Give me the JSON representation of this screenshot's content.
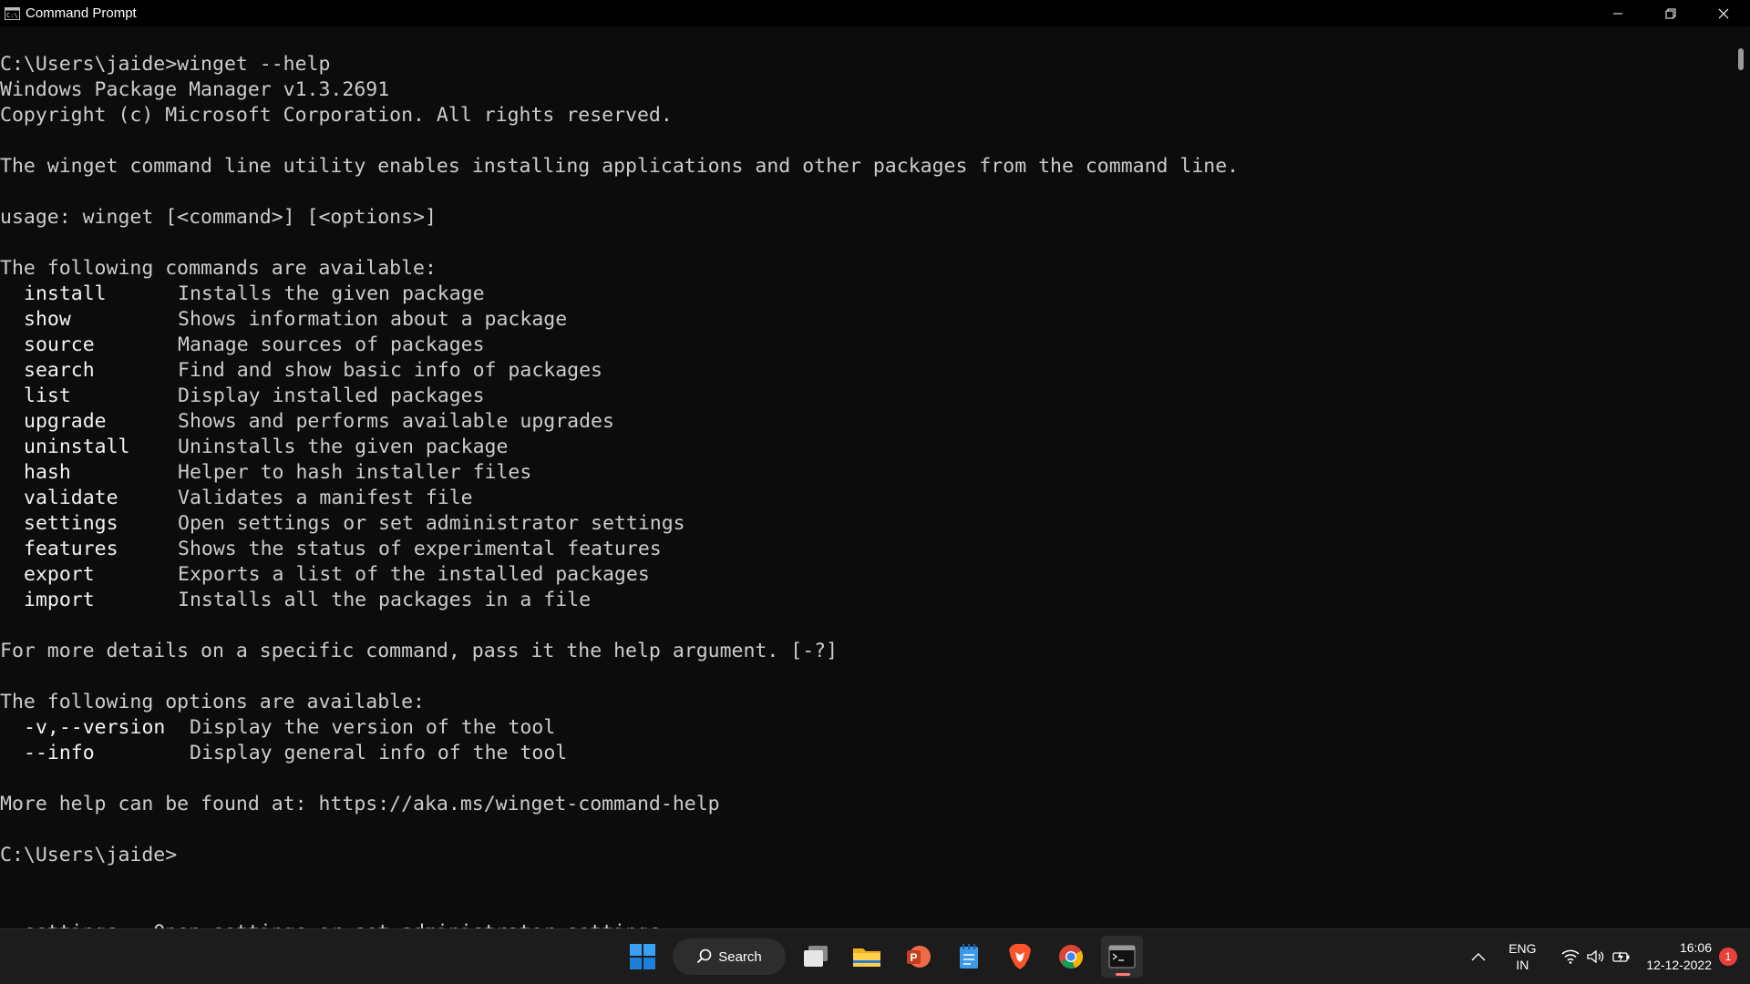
{
  "window": {
    "title": "Command Prompt",
    "controls": {
      "minimize": "minimize",
      "restore": "restore",
      "close": "close"
    }
  },
  "console": {
    "lines": [
      "C:\\Users\\jaide>winget --help",
      "Windows Package Manager v1.3.2691",
      "Copyright (c) Microsoft Corporation. All rights reserved.",
      "",
      "The winget command line utility enables installing applications and other packages from the command line.",
      "",
      "usage: winget [<command>] [<options>]",
      "",
      "The following commands are available:"
    ],
    "commands": [
      {
        "name": "install",
        "description": "Installs the given package"
      },
      {
        "name": "show",
        "description": "Shows information about a package"
      },
      {
        "name": "source",
        "description": "Manage sources of packages"
      },
      {
        "name": "search",
        "description": "Find and show basic info of packages"
      },
      {
        "name": "list",
        "description": "Display installed packages"
      },
      {
        "name": "upgrade",
        "description": "Shows and performs available upgrades"
      },
      {
        "name": "uninstall",
        "description": "Uninstalls the given package"
      },
      {
        "name": "hash",
        "description": "Helper to hash installer files"
      },
      {
        "name": "validate",
        "description": "Validates a manifest file"
      },
      {
        "name": "settings",
        "description": "Open settings or set administrator settings"
      },
      {
        "name": "features",
        "description": "Shows the status of experimental features"
      },
      {
        "name": "export",
        "description": "Exports a list of the installed packages"
      },
      {
        "name": "import",
        "description": "Installs all the packages in a file"
      }
    ],
    "details_line": "For more details on a specific command, pass it the help argument. [-?]",
    "options_header": "The following options are available:",
    "options": [
      {
        "name": "-v,--version",
        "description": "Display the version of the tool"
      },
      {
        "name": "--info",
        "description": "Display general info of the tool"
      }
    ],
    "help_line": "More help can be found at: https://aka.ms/winget-command-help",
    "prompt": "C:\\Users\\jaide>",
    "ghost_line": "  settings   Open settings or set administrator settings"
  },
  "taskbar": {
    "search_label": "Search",
    "apps": [
      "start",
      "task-view",
      "file-explorer",
      "powerpoint",
      "notepad",
      "brave",
      "chrome",
      "terminal"
    ],
    "tray": {
      "lang_top": "ENG",
      "lang_bottom": "IN",
      "time": "16:06",
      "date": "12-12-2022",
      "notification_count": "1"
    }
  },
  "colors": {
    "console_bg": "#0c0c0c",
    "console_fg": "#cccccc",
    "titlebar_bg": "#000000",
    "taskbar_bg": "#1c1c1c"
  }
}
